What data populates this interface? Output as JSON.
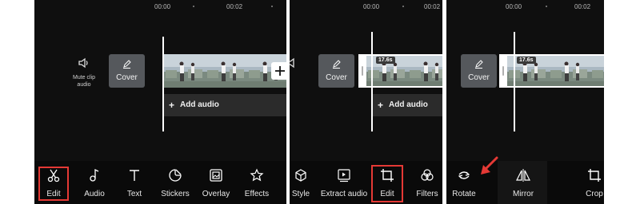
{
  "panels": [
    {
      "ruler": [
        "00:00",
        "00:02"
      ],
      "mute": {
        "label_line1": "Mute clip",
        "label_line2": "audio"
      },
      "cover_label": "Cover",
      "add_audio": "Add audio",
      "tools": [
        {
          "label": "Edit",
          "icon": "scissors-icon",
          "highlighted": true
        },
        {
          "label": "Audio",
          "icon": "music-note-icon"
        },
        {
          "label": "Text",
          "icon": "text-icon"
        },
        {
          "label": "Stickers",
          "icon": "sticker-icon"
        },
        {
          "label": "Overlay",
          "icon": "overlay-icon"
        },
        {
          "label": "Effects",
          "icon": "effects-icon"
        }
      ]
    },
    {
      "ruler": [
        "00:00",
        "00:02"
      ],
      "cover_label": "Cover",
      "clip_duration": "17.6s",
      "add_audio": "Add audio",
      "tools": [
        {
          "label": "Style",
          "icon": "cube-icon"
        },
        {
          "label": "Extract audio",
          "icon": "extract-audio-icon"
        },
        {
          "label": "Edit",
          "icon": "crop-icon",
          "highlighted": true
        },
        {
          "label": "Filters",
          "icon": "filters-icon"
        }
      ]
    },
    {
      "ruler": [
        "00:00",
        "00:02"
      ],
      "cover_label": "Cover",
      "clip_duration": "17.6s",
      "tools": [
        {
          "label": "Rotate",
          "icon": "rotate-icon"
        },
        {
          "label": "Mirror",
          "icon": "mirror-icon",
          "selected": true
        },
        {
          "label": "Crop",
          "icon": "crop-icon"
        }
      ]
    }
  ],
  "colors": {
    "highlight": "#e53935",
    "panel_bg": "#0f0f0f",
    "arrow": "#e53935"
  }
}
